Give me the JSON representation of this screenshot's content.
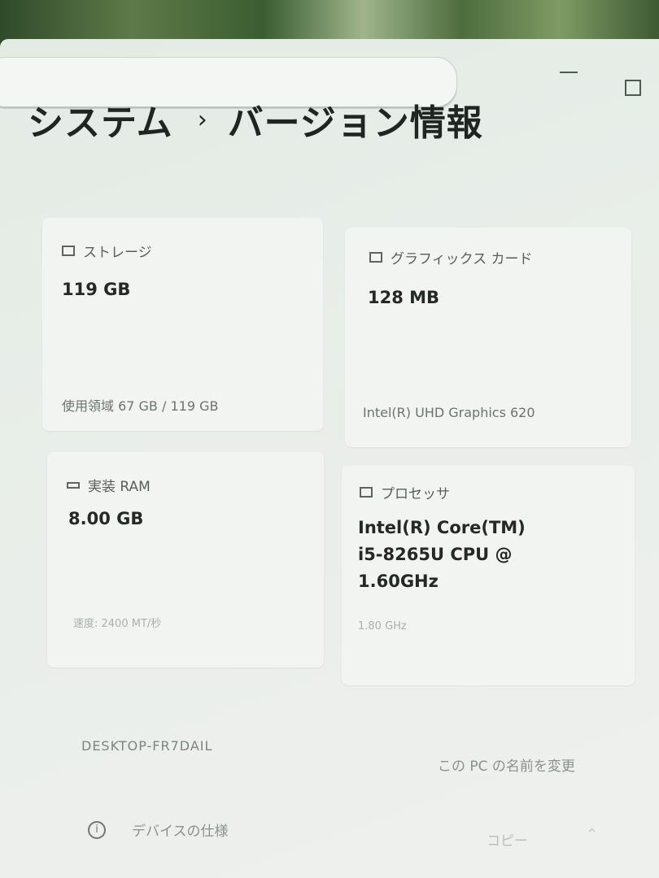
{
  "breadcrumb": {
    "parent": "システム",
    "separator": "›",
    "current": "バージョン情報"
  },
  "cards": {
    "storage": {
      "icon": "storage-icon",
      "label": "ストレージ",
      "value": "119 GB",
      "detail": "使用領域 67 GB / 119 GB"
    },
    "graphics": {
      "icon": "display-icon",
      "label": "グラフィックス カード",
      "value": "128 MB",
      "detail": "Intel(R) UHD Graphics 620"
    },
    "ram": {
      "icon": "memory-icon",
      "label": "実装 RAM",
      "value": "8.00 GB",
      "detail": "速度: 2400 MT/秒"
    },
    "processor": {
      "icon": "processor-icon",
      "label": "プロセッサ",
      "value_lines": [
        "Intel(R) Core(TM)",
        "i5-8265U CPU @",
        "1.60GHz"
      ],
      "detail": "1.80 GHz"
    }
  },
  "device": {
    "name": "DESKTOP-FR7DAIL",
    "rename_link": "この PC の名前を変更"
  },
  "specs": {
    "label": "デバイスの仕様",
    "copy": "コピー"
  },
  "colors": {
    "window_bg": "#e9eee9",
    "card_bg": "#f2f4f2",
    "text": "#232a26"
  }
}
